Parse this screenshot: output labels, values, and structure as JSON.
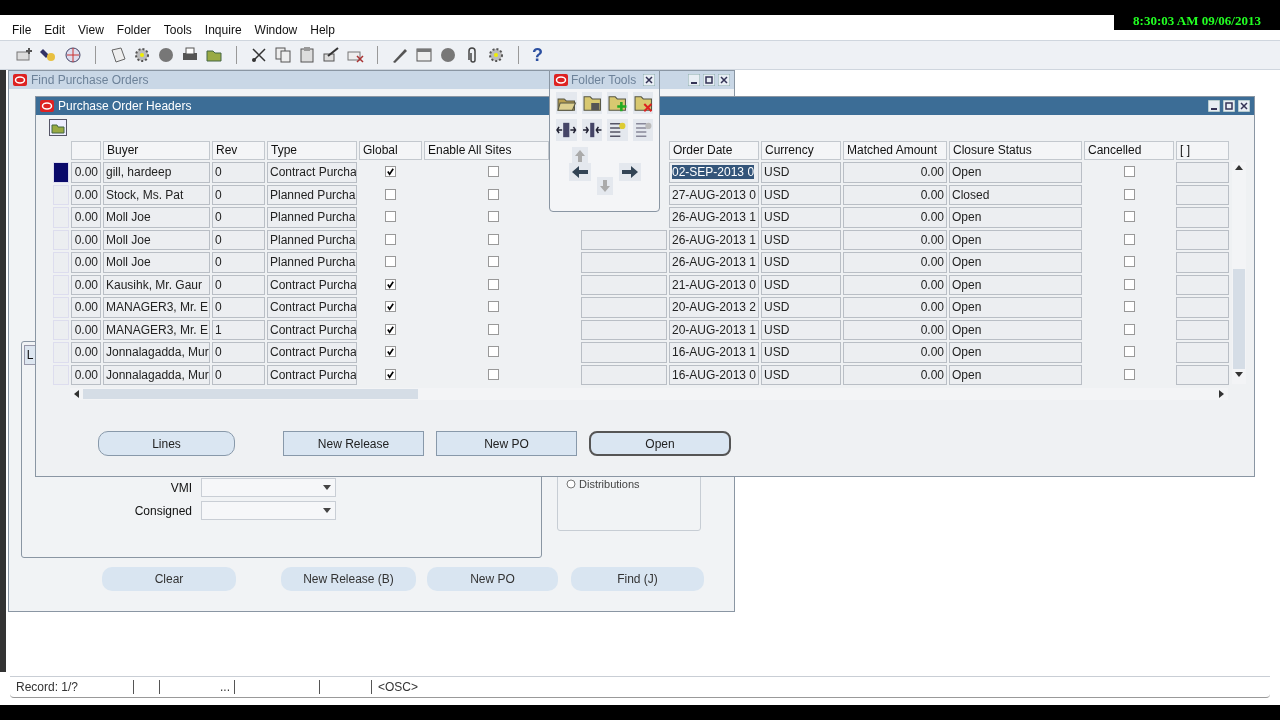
{
  "clock": "8:30:03 AM 09/06/2013",
  "menu": [
    "File",
    "Edit",
    "View",
    "Folder",
    "Tools",
    "Inquire",
    "Window",
    "Help"
  ],
  "toolbar": {
    "help": "?"
  },
  "find_window": {
    "title": "Find Purchase Orders",
    "tab": "L",
    "fields": [
      {
        "label": "VMI"
      },
      {
        "label": "Consigned"
      }
    ],
    "radio": {
      "label": "Distributions",
      "selected": false
    },
    "buttons": [
      {
        "label": "Clear"
      },
      {
        "label": "New Release (B)"
      },
      {
        "label": "New PO"
      },
      {
        "label": "Find (J)"
      }
    ]
  },
  "folder_tools": {
    "title": "Folder Tools"
  },
  "po_window": {
    "title": "Purchase Order Headers",
    "columns": [
      "Buyer",
      "Rev",
      "Type",
      "Global",
      "Enable All Sites",
      "Order Date",
      "Currency",
      "Matched Amount",
      "Closure Status",
      "Cancelled",
      "[ ]"
    ],
    "rows": [
      {
        "selected": true,
        "amount": "0.00",
        "buyer": "gill, hardeep",
        "rev": "0",
        "type": "Contract Purcha",
        "global": true,
        "enable_all_sites": false,
        "order_date": "02-SEP-2013 0",
        "currency": "USD",
        "matched_amount": "0.00",
        "closure_status": "Open",
        "cancelled": false
      },
      {
        "selected": false,
        "amount": "0.00",
        "buyer": "Stock, Ms. Pat",
        "rev": "0",
        "type": "Planned Purcha",
        "global": false,
        "enable_all_sites": false,
        "order_date": "27-AUG-2013 0",
        "currency": "USD",
        "matched_amount": "0.00",
        "closure_status": "Closed",
        "cancelled": false
      },
      {
        "selected": false,
        "amount": "0.00",
        "buyer": "Moll Joe",
        "rev": "0",
        "type": "Planned Purcha",
        "global": false,
        "enable_all_sites": false,
        "order_date": "26-AUG-2013 1",
        "currency": "USD",
        "matched_amount": "0.00",
        "closure_status": "Open",
        "cancelled": false
      },
      {
        "selected": false,
        "amount": "0.00",
        "buyer": "Moll Joe",
        "rev": "0",
        "type": "Planned Purcha",
        "global": false,
        "enable_all_sites": false,
        "order_date": "26-AUG-2013 1",
        "currency": "USD",
        "matched_amount": "0.00",
        "closure_status": "Open",
        "cancelled": false
      },
      {
        "selected": false,
        "amount": "0.00",
        "buyer": "Moll Joe",
        "rev": "0",
        "type": "Planned Purcha",
        "global": false,
        "enable_all_sites": false,
        "order_date": "26-AUG-2013 1",
        "currency": "USD",
        "matched_amount": "0.00",
        "closure_status": "Open",
        "cancelled": false
      },
      {
        "selected": false,
        "amount": "0.00",
        "buyer": "Kausihk, Mr. Gaur",
        "rev": "0",
        "type": "Contract Purcha",
        "global": true,
        "enable_all_sites": false,
        "order_date": "21-AUG-2013 0",
        "currency": "USD",
        "matched_amount": "0.00",
        "closure_status": "Open",
        "cancelled": false
      },
      {
        "selected": false,
        "amount": "0.00",
        "buyer": "MANAGER3, Mr. E",
        "rev": "0",
        "type": "Contract Purcha",
        "global": true,
        "enable_all_sites": false,
        "order_date": "20-AUG-2013 2",
        "currency": "USD",
        "matched_amount": "0.00",
        "closure_status": "Open",
        "cancelled": false
      },
      {
        "selected": false,
        "amount": "0.00",
        "buyer": "MANAGER3, Mr. E",
        "rev": "1",
        "type": "Contract Purcha",
        "global": true,
        "enable_all_sites": false,
        "order_date": "20-AUG-2013 1",
        "currency": "USD",
        "matched_amount": "0.00",
        "closure_status": "Open",
        "cancelled": false
      },
      {
        "selected": false,
        "amount": "0.00",
        "buyer": "Jonnalagadda, Mur",
        "rev": "0",
        "type": "Contract Purcha",
        "global": true,
        "enable_all_sites": false,
        "order_date": "16-AUG-2013 1",
        "currency": "USD",
        "matched_amount": "0.00",
        "closure_status": "Open",
        "cancelled": false
      },
      {
        "selected": false,
        "amount": "0.00",
        "buyer": "Jonnalagadda, Mur",
        "rev": "0",
        "type": "Contract Purcha",
        "global": true,
        "enable_all_sites": false,
        "order_date": "16-AUG-2013 0",
        "currency": "USD",
        "matched_amount": "0.00",
        "closure_status": "Open",
        "cancelled": false
      }
    ],
    "buttons": [
      {
        "label": "Lines",
        "default": false
      },
      {
        "label": "New Release",
        "default": false
      },
      {
        "label": "New PO",
        "default": false
      },
      {
        "label": "Open",
        "default": true
      }
    ]
  },
  "status_bar": {
    "record": "Record: 1/?",
    "segment_3": "...",
    "mode": "<OSC>"
  }
}
